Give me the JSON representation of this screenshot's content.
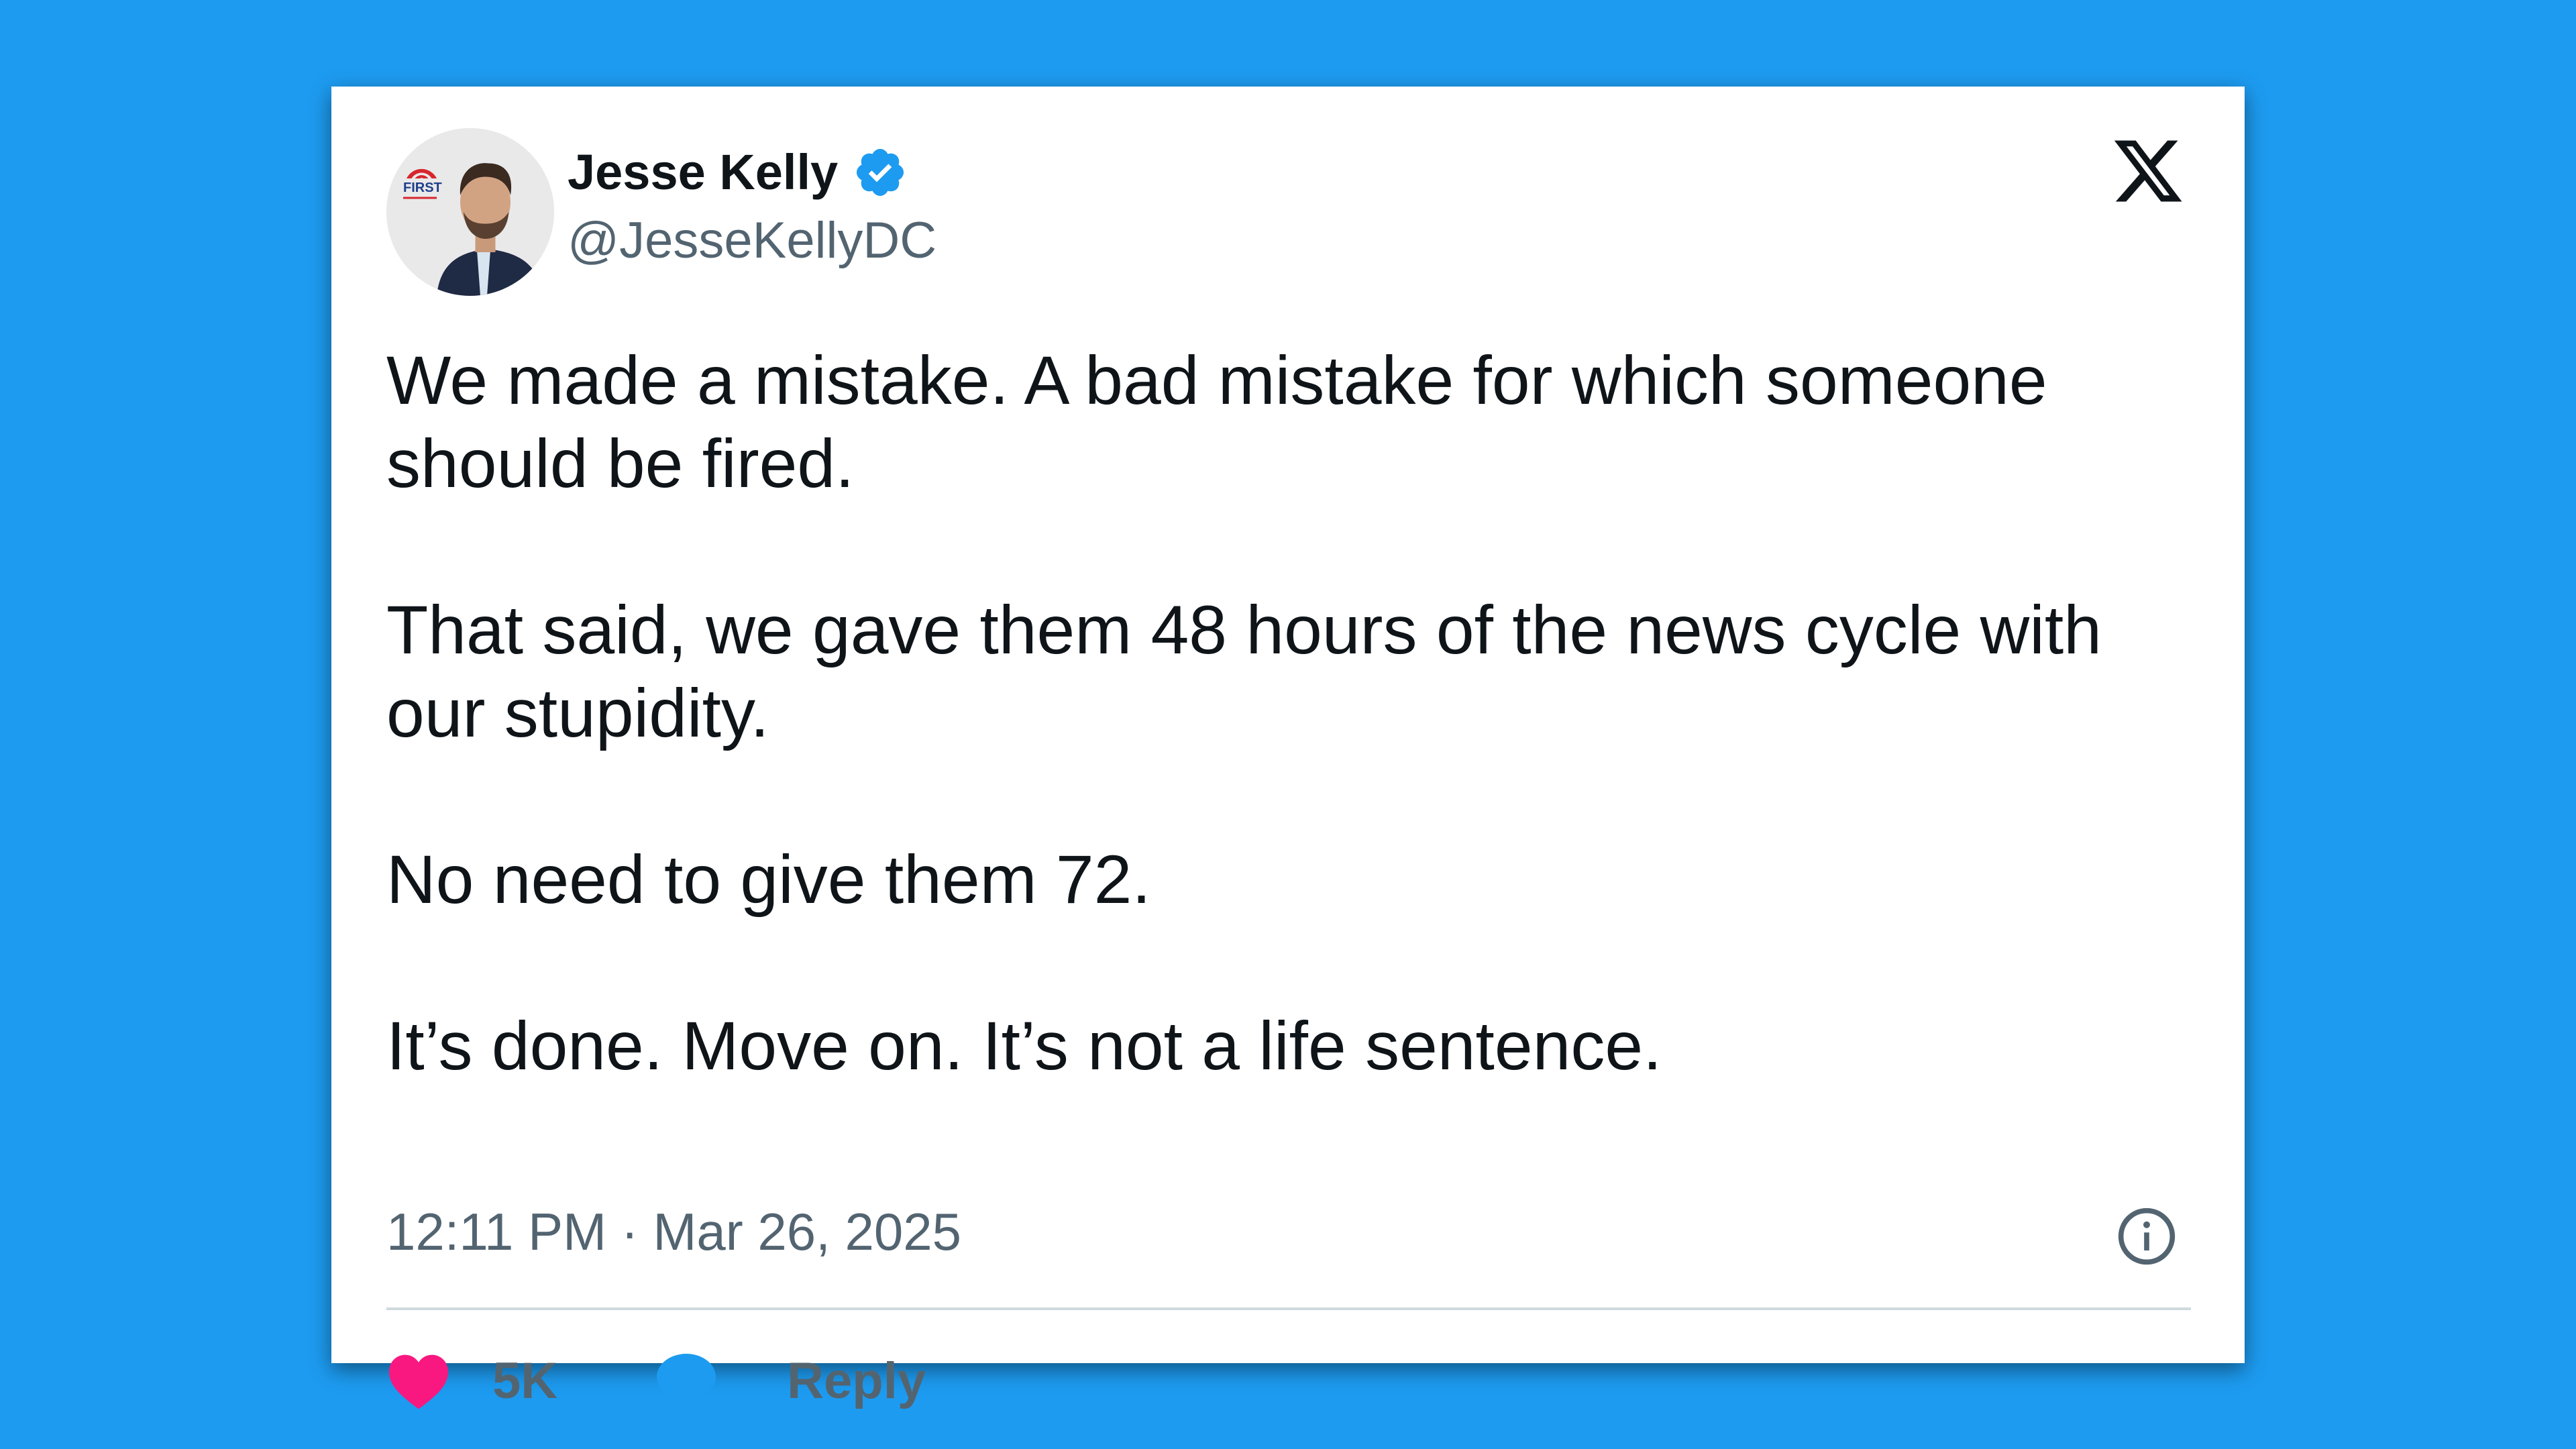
{
  "author": {
    "display_name": "Jesse Kelly",
    "handle": "@JesseKellyDC",
    "verified": true,
    "avatar_logo_text": "FIRST"
  },
  "platform": {
    "logo_icon": "x-logo-icon"
  },
  "tweet": {
    "paragraphs": [
      "We made a mistake. A bad mistake for which someone should be fired.",
      "That said, we gave them 48 hours of the news cycle with our stupidity.",
      "No need to give them 72.",
      "It’s done. Move on. It’s not a life sentence."
    ],
    "timestamp": "12:11 PM · Mar 26, 2025"
  },
  "actions": {
    "like_count": "5K",
    "reply_label": "Reply"
  },
  "colors": {
    "background": "#1d9bf0",
    "card": "#ffffff",
    "text_primary": "#0f1419",
    "text_secondary": "#536471",
    "verified": "#1d9bf0",
    "heart": "#f91880",
    "reply": "#1d9bf0",
    "divider": "#cfd9de"
  }
}
